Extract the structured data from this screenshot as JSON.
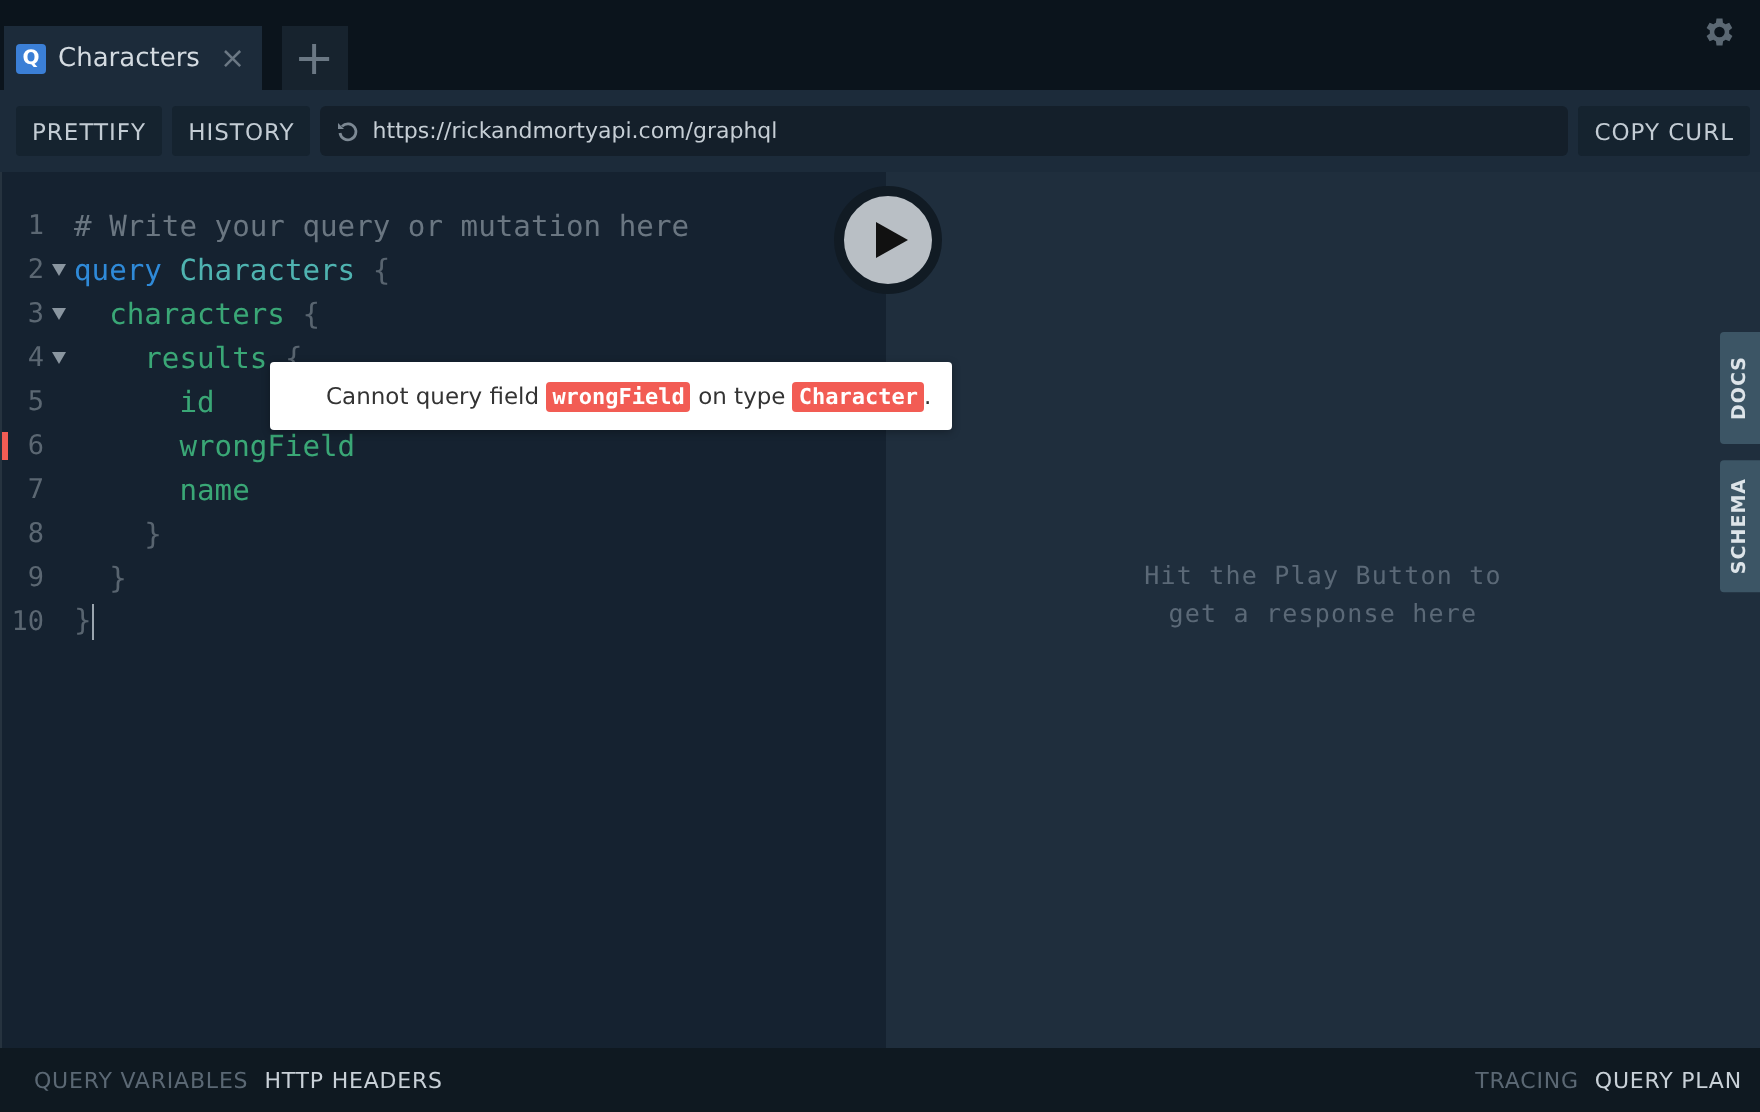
{
  "tabs": [
    {
      "icon_letter": "Q",
      "label": "Characters",
      "close": "×",
      "selected": true
    }
  ],
  "new_tab": "+",
  "toolbar": {
    "buttons": [
      "PRETTIFY",
      "HISTORY"
    ],
    "url": "https://rickandmortyapi.com/graphql",
    "copy_button": "COPY CURL"
  },
  "editor": {
    "lines": [
      {
        "number": "1",
        "fold": false,
        "error": false,
        "tokens": [
          {
            "text": "# Write your query or mutation here",
            "kind": "comment"
          }
        ]
      },
      {
        "number": "2",
        "fold": true,
        "error": false,
        "tokens": [
          {
            "text": "query",
            "kind": "keyword"
          },
          {
            "text": " Characters",
            "kind": "def"
          },
          {
            "text": " {",
            "kind": "punct"
          }
        ]
      },
      {
        "number": "3",
        "fold": true,
        "error": false,
        "tokens": [
          {
            "text": "  characters",
            "kind": "field"
          },
          {
            "text": " {",
            "kind": "punct"
          }
        ]
      },
      {
        "number": "4",
        "fold": true,
        "error": false,
        "tokens": [
          {
            "text": "    results",
            "kind": "field"
          },
          {
            "text": " {",
            "kind": "punct"
          }
        ]
      },
      {
        "number": "5",
        "fold": false,
        "error": false,
        "tokens": [
          {
            "text": "      id",
            "kind": "field"
          }
        ]
      },
      {
        "number": "6",
        "fold": false,
        "error": true,
        "tokens": [
          {
            "text": "      wrongField",
            "kind": "field"
          }
        ]
      },
      {
        "number": "7",
        "fold": false,
        "error": false,
        "tokens": [
          {
            "text": "      name",
            "kind": "field"
          }
        ]
      },
      {
        "number": "8",
        "fold": false,
        "error": false,
        "tokens": [
          {
            "text": "    }",
            "kind": "punct"
          }
        ]
      },
      {
        "number": "9",
        "fold": false,
        "error": false,
        "tokens": [
          {
            "text": "  }",
            "kind": "punct"
          }
        ]
      },
      {
        "number": "10",
        "fold": false,
        "error": false,
        "tokens": [
          {
            "text": "}",
            "kind": "punct"
          }
        ]
      }
    ],
    "tooltip": [
      {
        "text": "Cannot query field ",
        "kind": "text"
      },
      {
        "text": "wrongField",
        "kind": "code"
      },
      {
        "text": " on type ",
        "kind": "text"
      },
      {
        "text": "Character",
        "kind": "code"
      },
      {
        "text": ".",
        "kind": "text"
      }
    ]
  },
  "result": {
    "message": "Hit the Play Button to\nget a response here"
  },
  "side_tabs": [
    "DOCS",
    "SCHEMA"
  ],
  "bottom_left": [
    {
      "label": "QUERY VARIABLES",
      "selected": false
    },
    {
      "label": "HTTP HEADERS",
      "selected": true
    }
  ],
  "bottom_right": [
    {
      "label": "TRACING",
      "selected": false
    },
    {
      "label": "QUERY PLAN",
      "selected": true
    }
  ]
}
